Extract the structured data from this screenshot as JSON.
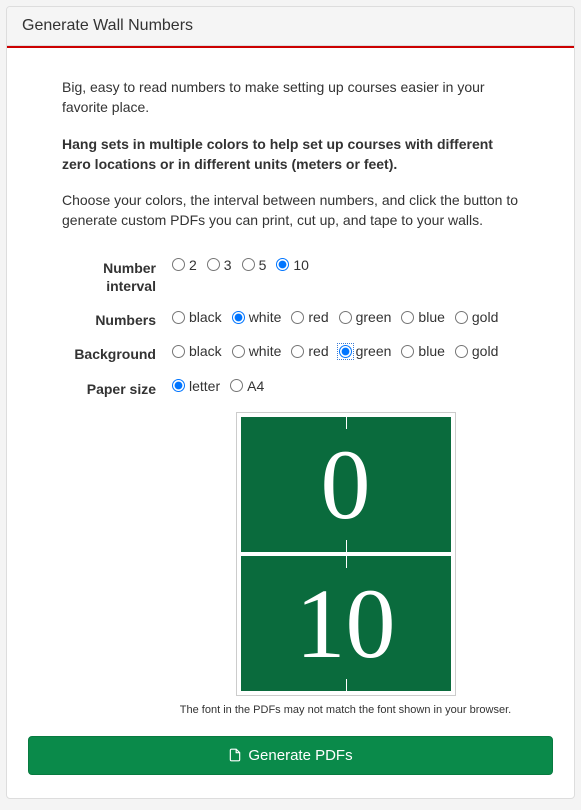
{
  "panel": {
    "title": "Generate Wall Numbers"
  },
  "intro": {
    "p1": "Big, easy to read numbers to make setting up courses easier in your favorite place.",
    "p2": "Hang sets in multiple colors to help set up courses with different zero locations or in different units (meters or feet).",
    "p3": "Choose your colors, the interval between numbers, and click the button to generate custom PDFs you can print, cut up, and tape to your walls."
  },
  "form": {
    "interval": {
      "label": "Number interval",
      "options": [
        "2",
        "3",
        "5",
        "10"
      ],
      "selected": "10"
    },
    "numbers": {
      "label": "Numbers",
      "options": [
        "black",
        "white",
        "red",
        "green",
        "blue",
        "gold"
      ],
      "selected": "white"
    },
    "background": {
      "label": "Background",
      "options": [
        "black",
        "white",
        "red",
        "green",
        "blue",
        "gold"
      ],
      "selected": "green",
      "focused": "green"
    },
    "paper": {
      "label": "Paper size",
      "options": [
        "letter",
        "A4"
      ],
      "selected": "letter"
    }
  },
  "preview": {
    "bg_color": "#0a6b3d",
    "fg_color": "#ffffff",
    "first": "0",
    "second": "10",
    "font_note": "The font in the PDFs may not match the font shown in your browser."
  },
  "button": {
    "label": "Generate PDFs"
  }
}
